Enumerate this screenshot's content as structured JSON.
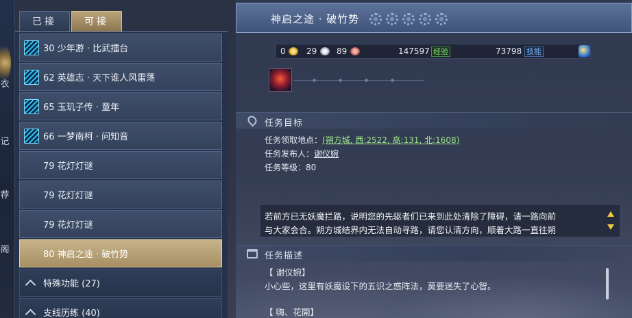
{
  "left_strip": {
    "glyphs": [
      "衣",
      "记",
      "荐",
      "阁"
    ]
  },
  "tabs": [
    {
      "label": "已接",
      "active": false
    },
    {
      "label": "可接",
      "active": true
    }
  ],
  "quest_list": [
    {
      "text": "30 少年游 · 比武擂台",
      "has_icon": true
    },
    {
      "text": "62 英雄志 · 天下谁人风雷荡",
      "has_icon": true
    },
    {
      "text": "65 玉玑子传 · 童年",
      "has_icon": true
    },
    {
      "text": "66 一梦南柯 · 问知音",
      "has_icon": true
    },
    {
      "text": "79 花灯灯谜",
      "has_icon": false
    },
    {
      "text": "79 花灯灯谜",
      "has_icon": false
    },
    {
      "text": "79 花灯灯谜",
      "has_icon": false
    },
    {
      "text": "80 神启之途 · 破竹势",
      "has_icon": false,
      "selected": true
    }
  ],
  "categories": [
    {
      "text": "特殊功能 (27)"
    },
    {
      "text": "支线历练 (40)"
    }
  ],
  "quest": {
    "title": "神启之途 · 破竹势",
    "stars": 5,
    "rewards": {
      "gold": "0",
      "silver": "29",
      "copper": "89",
      "exp": "147597",
      "exp_tag": "经验",
      "skill": "73798",
      "skill_tag": "技能"
    },
    "objective_header": "任务目标",
    "location_label": "任务领取地点：",
    "location_value": "(朔方城, 西:2522, 高:131, 北:1608)",
    "publisher_label": "任务发布人：",
    "publisher_value": "谢仪婉",
    "level_label": "任务等级：",
    "level_value": "80",
    "hint_line1": "若前方已无妖魔拦路，说明您的先驱者们已来到此处清除了障碍，请一路向前",
    "hint_line2": "与大家会合。朔方城结界内无法自动寻路，请您认清方向，顺着大路一直往朔",
    "description_header": "任务描述",
    "desc_speaker1": "【 谢仪婉】",
    "desc_text1": "小心些，这里有妖魔设下的五识之惑阵法，莫要迷失了心智。",
    "desc_speaker2": "【 嗨、花開】"
  },
  "colors": {
    "selected_row": "#b29b70",
    "exp_tag": "#7fe07a",
    "skill_tag": "#7fb6ff",
    "link": "#9fe88f",
    "arrow": "#f0c940"
  }
}
